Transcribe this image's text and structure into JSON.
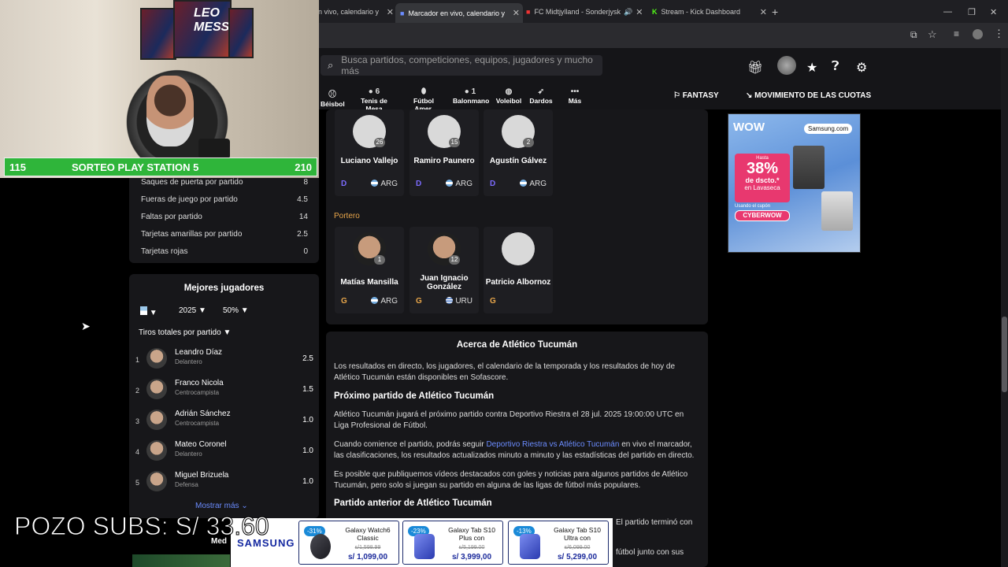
{
  "browser": {
    "tabs": [
      {
        "label": "n vivo, calendario y",
        "active": false
      },
      {
        "label": "Marcador en vivo, calendario y",
        "active": true
      },
      {
        "label": "FC Midtjylland - Sonderjysk",
        "active": false
      },
      {
        "label": "Stream - Kick Dashboard",
        "active": false
      }
    ]
  },
  "header": {
    "search_placeholder": "Busca partidos, competiciones, equipos, jugadores y mucho más",
    "sports": [
      {
        "label": "Béisbol",
        "count": ""
      },
      {
        "label": "Tenis de Mesa",
        "count": "6"
      },
      {
        "label": "Fútbol Amer.",
        "count": ""
      },
      {
        "label": "Balonmano",
        "count": "1"
      },
      {
        "label": "Voleibol",
        "count": ""
      },
      {
        "label": "Dardos",
        "count": ""
      },
      {
        "label": "Más",
        "count": ""
      }
    ],
    "fantasy": "FANTASY",
    "odds": "MOVIMIENTO DE LAS CUOTAS"
  },
  "stream": {
    "score_left": "115",
    "score_title": "SORTEO PLAY STATION 5",
    "score_right": "210",
    "pozo": "POZO SUBS: S/ 33.60",
    "poster_text": "LEO MESSI"
  },
  "stats": [
    {
      "label": "Saques de puerta por partido",
      "value": "8"
    },
    {
      "label": "Fueras de juego por partido",
      "value": "4.5"
    },
    {
      "label": "Faltas por partido",
      "value": "14"
    },
    {
      "label": "Tarjetas amarillas por partido",
      "value": "2.5"
    },
    {
      "label": "Tarjetas rojas",
      "value": "0"
    }
  ],
  "best_players": {
    "title": "Mejores jugadores",
    "year": "2025",
    "pct": "50%",
    "metric": "Tiros totales por partido",
    "rows": [
      {
        "rank": "1",
        "name": "Leandro Díaz",
        "pos": "Delantero",
        "value": "2.5"
      },
      {
        "rank": "2",
        "name": "Franco Nicola",
        "pos": "Centrocampista",
        "value": "1.5"
      },
      {
        "rank": "3",
        "name": "Adrián Sánchez",
        "pos": "Centrocampista",
        "value": "1.0"
      },
      {
        "rank": "4",
        "name": "Mateo Coronel",
        "pos": "Delantero",
        "value": "1.0"
      },
      {
        "rank": "5",
        "name": "Miguel Brizuela",
        "pos": "Defensa",
        "value": "1.0"
      }
    ],
    "more": "Mostrar más",
    "next_title": "Med"
  },
  "defenders": [
    {
      "num": "26",
      "name": "Luciano Vallejo",
      "pos": "D",
      "nat": "ARG"
    },
    {
      "num": "15",
      "name": "Ramiro Paunero",
      "pos": "D",
      "nat": "ARG"
    },
    {
      "num": "2",
      "name": "Agustín Gálvez",
      "pos": "D",
      "nat": "ARG"
    }
  ],
  "goalkeepers_title": "Portero",
  "goalkeepers": [
    {
      "num": "1",
      "name": "Matías Mansilla",
      "pos": "G",
      "nat": "ARG"
    },
    {
      "num": "12",
      "name": "Juan Ignacio González",
      "pos": "G",
      "nat": "URU"
    },
    {
      "num": "",
      "name": "Patricio Albornoz",
      "pos": "G",
      "nat": ""
    }
  ],
  "about": {
    "title": "Acerca de Atlético Tucumán",
    "p1": "Los resultados en directo, los jugadores, el calendario de la temporada y los resultados de hoy de Atlético Tucumán están disponibles en Sofascore.",
    "h_next": "Próximo partido de Atlético Tucumán",
    "p2": "Atlético Tucumán jugará el próximo partido contra Deportivo Riestra el 28 jul. 2025 19:00:00 UTC en Liga Profesional de Fútbol.",
    "p3_a": "Cuando comience el partido, podrás seguir ",
    "p3_link": "Deportivo Riestra vs Atlético Tucumán",
    "p3_b": " en vivo el marcador, las clasificaciones, los resultados actualizados minuto a minuto y las estadísticas del partido en directo.",
    "p4": "Es posible que publiquemos vídeos destacados con goles y noticias para algunos partidos de Atlético Tucumán, pero solo si juegan su partido en alguna de las ligas de fútbol más populares.",
    "h_prev": "Partido anterior de Atlético Tucumán",
    "p5_frag": "El partido terminó con",
    "p6_frag": "fútbol junto con sus"
  },
  "ad": {
    "brand": "WOW",
    "samsung": "Samsung.com",
    "hasta": "Hasta",
    "pct": "38%",
    "desc": "de dscto.*",
    "where": "en Lavaseca",
    "coupon_lbl": "Usando el cupón",
    "coupon": "CYBERWOW"
  },
  "samsung_banner": {
    "brand": "SAMSUNG",
    "products": [
      {
        "disc": "-31%",
        "name": "Galaxy Watch6 Classic",
        "old": "s/1,598.99",
        "price": "s/ 1,099,00"
      },
      {
        "disc": "-23%",
        "name": "Galaxy Tab S10 Plus con",
        "old": "s/5,199.00",
        "price": "s/ 3,999,00"
      },
      {
        "disc": "-13%",
        "name": "Galaxy Tab S10 Ultra con",
        "old": "s/6,099.00",
        "price": "s/ 5,299,00"
      }
    ]
  }
}
